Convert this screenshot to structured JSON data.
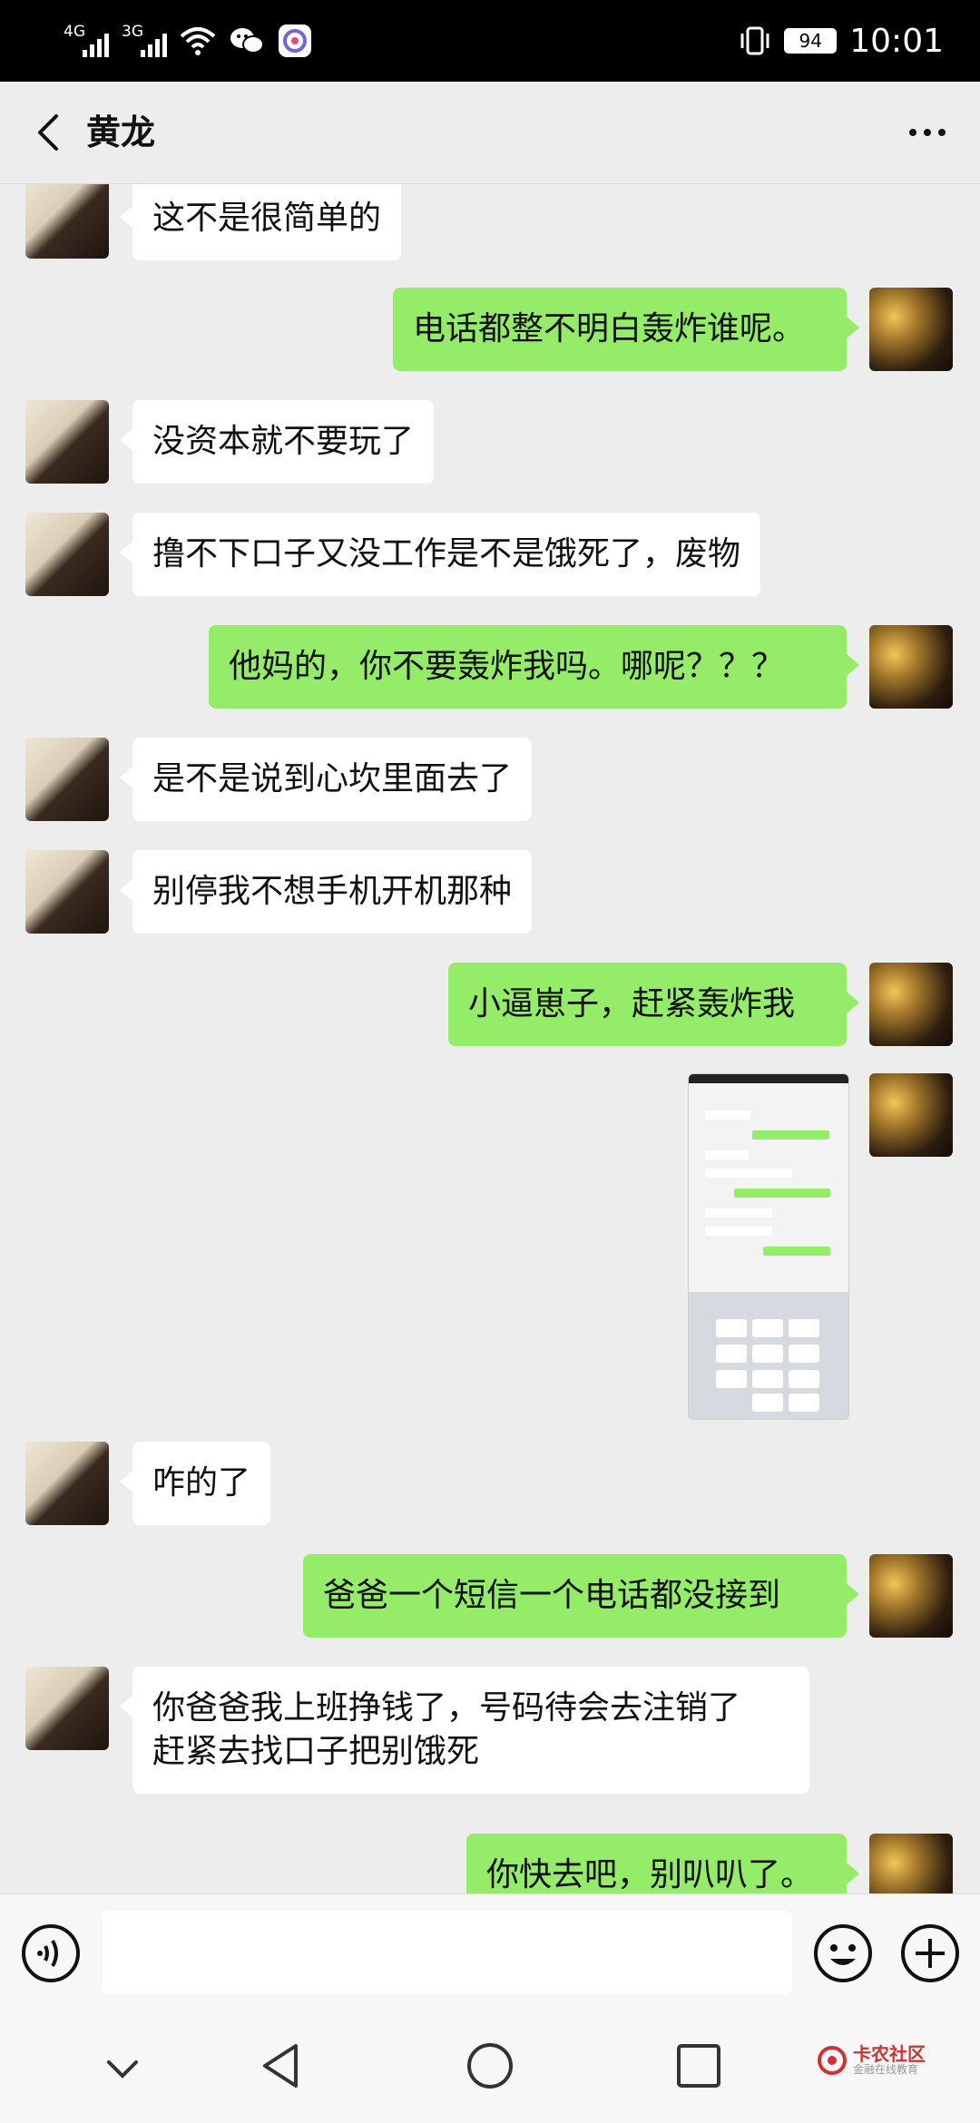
{
  "status_bar": {
    "network1": "4G",
    "network2": "3G",
    "battery": "94",
    "time": "10:01"
  },
  "header": {
    "title": "黄龙"
  },
  "messages": [
    {
      "side": "in",
      "text": "这不是很简单的"
    },
    {
      "side": "out",
      "text": "电话都整不明白轰炸谁呢。"
    },
    {
      "side": "in",
      "text": "没资本就不要玩了"
    },
    {
      "side": "in",
      "text": "撸不下口子又没工作是不是饿死了，废物"
    },
    {
      "side": "out",
      "text": "他妈的，你不要轰炸我吗。哪呢？？？"
    },
    {
      "side": "in",
      "text": "是不是说到心坎里面去了"
    },
    {
      "side": "in",
      "text": "别停我不想手机开机那种"
    },
    {
      "side": "out",
      "text": "小逼崽子，赶紧轰炸我"
    },
    {
      "side": "out",
      "type": "image",
      "text": ""
    },
    {
      "side": "in",
      "text": "咋的了"
    },
    {
      "side": "out",
      "text": "爸爸一个短信一个电话都没接到"
    },
    {
      "side": "in",
      "lines": [
        "你爸爸我上班挣钱了，号码待会去注销了",
        "赶紧去找口子把别饿死"
      ]
    },
    {
      "side": "out",
      "text": "你快去吧，别叭叭了。"
    }
  ],
  "input_bar": {
    "placeholder": ""
  },
  "watermark": {
    "line1": "卡农社区",
    "line2": "金融在线教育"
  }
}
